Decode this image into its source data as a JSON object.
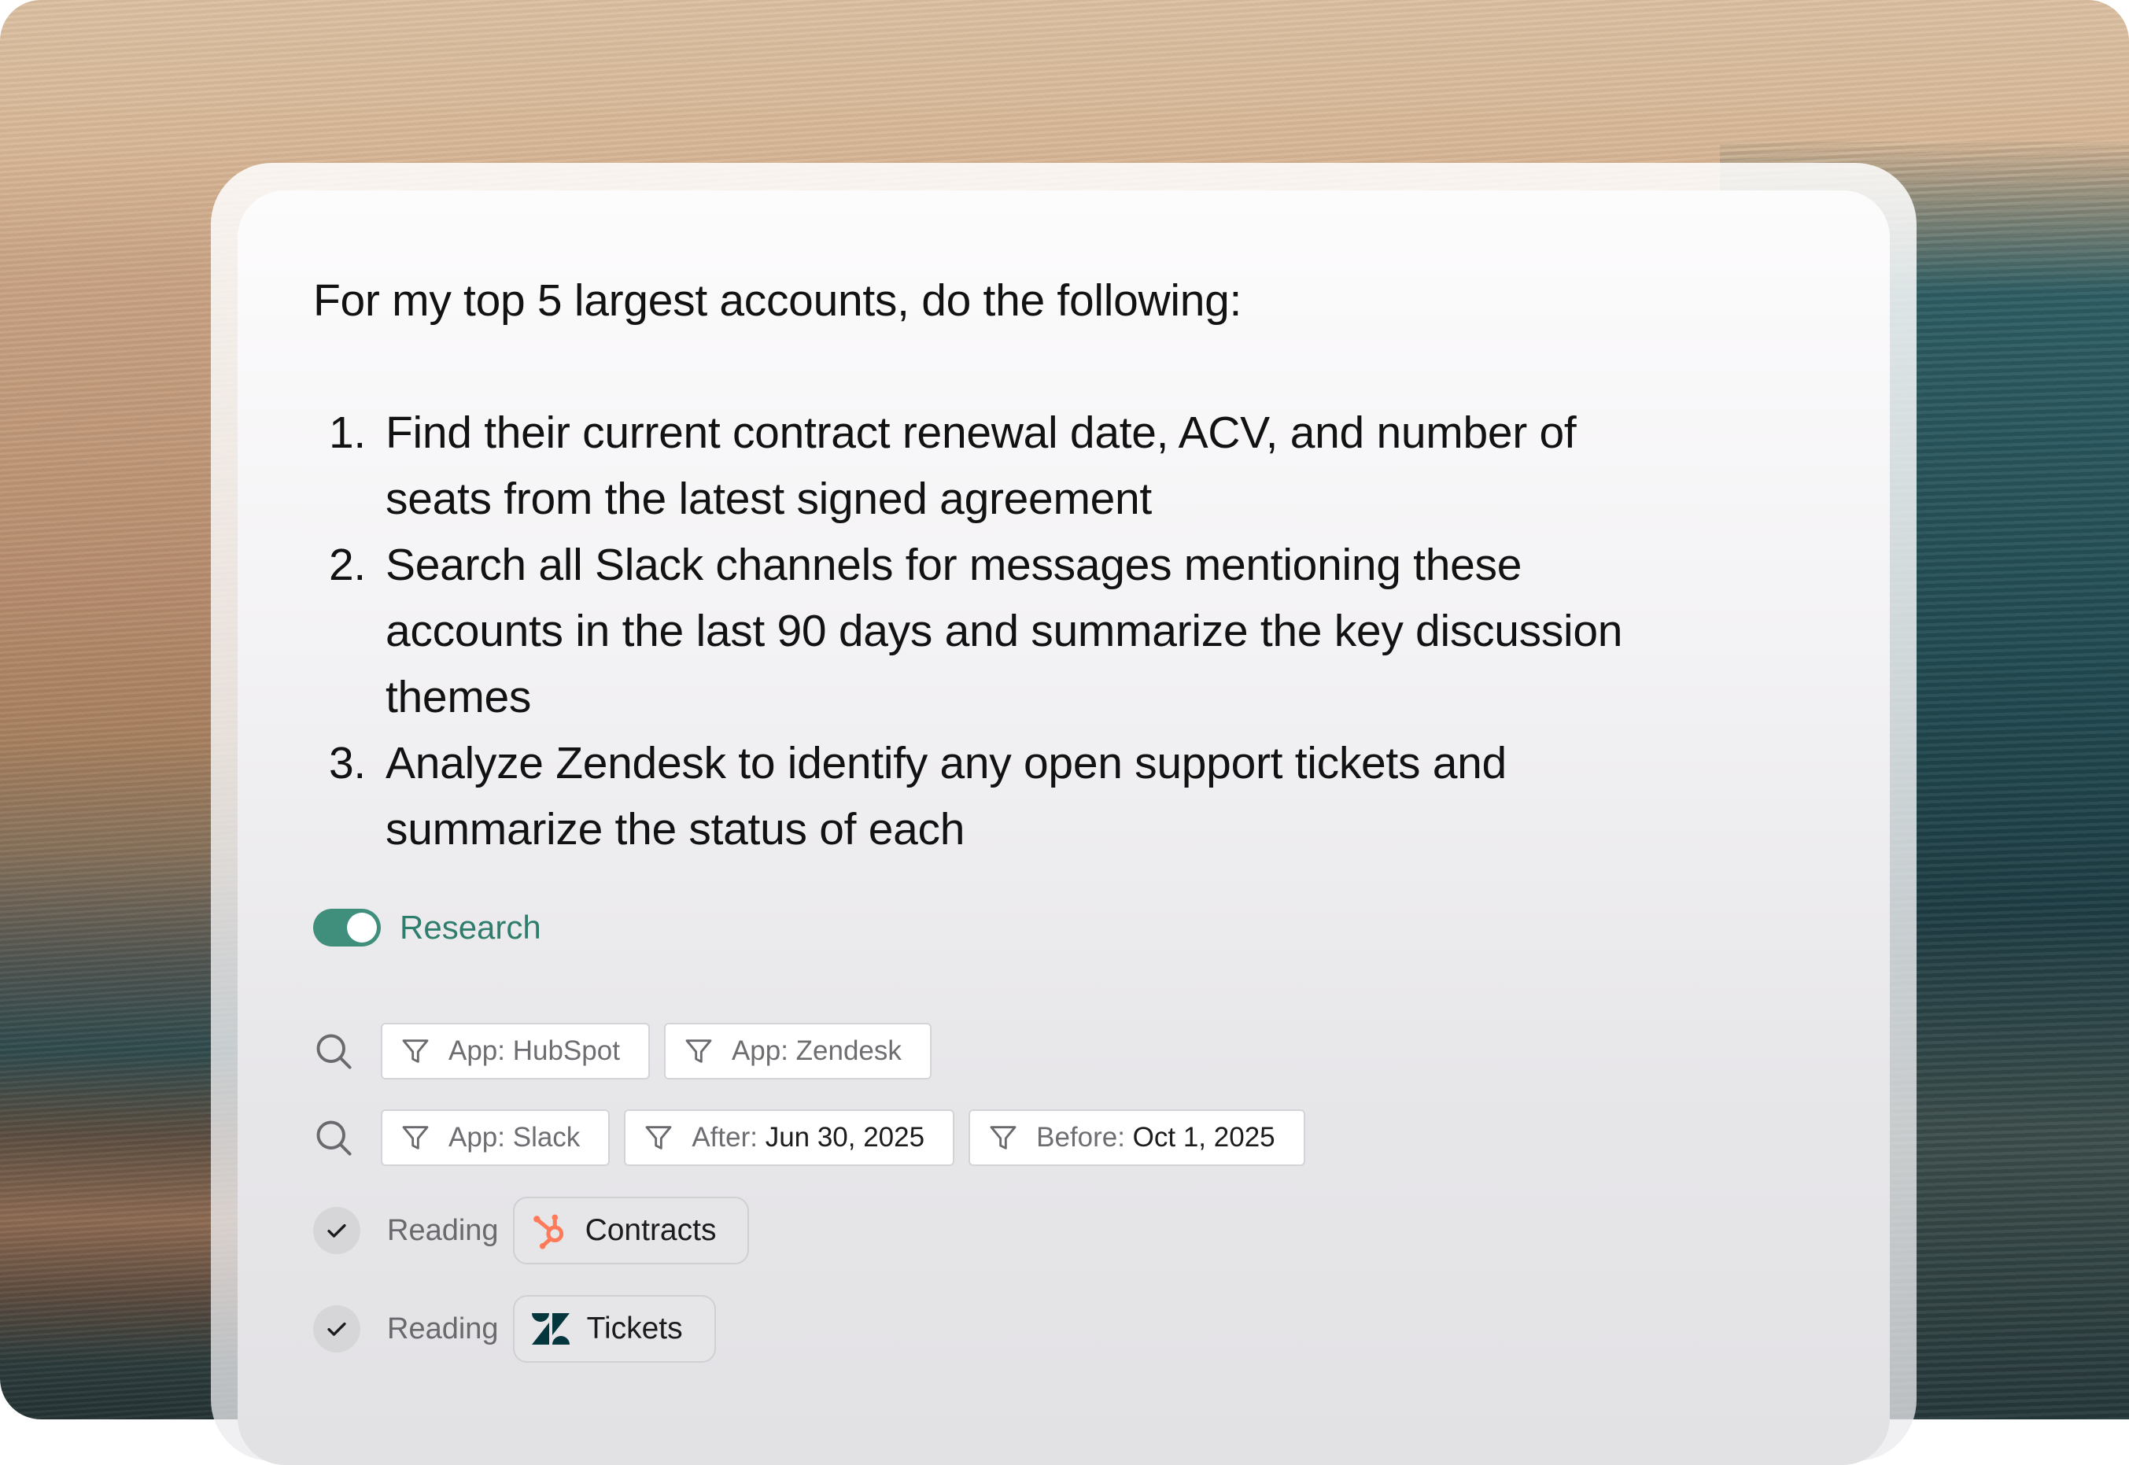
{
  "prompt": {
    "intro": "For my top 5 largest accounts, do the following:",
    "steps": [
      {
        "num": "1.",
        "line1": "Find their current contract renewal date, ACV, and number of",
        "line2": "seats from the latest signed agreement"
      },
      {
        "num": "2.",
        "line1": "Search all Slack channels for messages mentioning these",
        "line2": "accounts in the last 90 days and summarize the key discussion",
        "line3": "themes"
      },
      {
        "num": "3.",
        "line1": "Analyze Zendesk to identify any open support tickets and",
        "line2": "summarize the status of each"
      }
    ]
  },
  "research": {
    "label": "Research",
    "enabled": true,
    "color": "#3f8f7c"
  },
  "searches": [
    {
      "icon": "search-icon",
      "filters": [
        {
          "icon": "filter-icon",
          "key": "App: HubSpot",
          "value": ""
        },
        {
          "icon": "filter-icon",
          "key": "App: Zendesk",
          "value": ""
        }
      ]
    },
    {
      "icon": "search-icon",
      "filters": [
        {
          "icon": "filter-icon",
          "key": "App: Slack",
          "value": ""
        },
        {
          "icon": "filter-icon",
          "key": "After: ",
          "value": "Jun 30, 2025"
        },
        {
          "icon": "filter-icon",
          "key": "Before: ",
          "value": "Oct 1, 2025"
        }
      ]
    }
  ],
  "readings": [
    {
      "status": "Reading",
      "icon": "hubspot-icon",
      "source": "Contracts",
      "icon_color": "#ff7a59"
    },
    {
      "status": "Reading",
      "icon": "zendesk-icon",
      "source": "Tickets",
      "icon_color": "#03363d"
    }
  ]
}
